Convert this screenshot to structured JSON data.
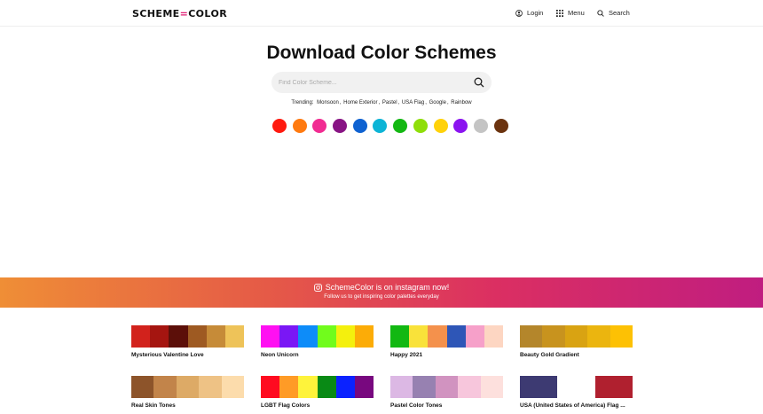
{
  "header": {
    "logo_left": "SCHEME",
    "logo_mid": "=",
    "logo_right": "COLOR",
    "nav": {
      "login": "Login",
      "menu": "Menu",
      "search": "Search"
    }
  },
  "hero": {
    "title": "Download Color Schemes",
    "search_placeholder": "Find Color Scheme...",
    "trending_label": "Trending:",
    "trending": [
      "Monsoon",
      "Home Exterior",
      "Pastel",
      "USA Flag",
      "Google",
      "Rainbow"
    ],
    "color_dots": [
      "#ff1a0f",
      "#ff7a10",
      "#f12c92",
      "#881484",
      "#0f62d1",
      "#0db4d6",
      "#14b813",
      "#8fde0a",
      "#ffd20a",
      "#8b14f0",
      "#c4c4c4",
      "#6b330f"
    ]
  },
  "banner": {
    "title": "SchemeColor is on instagram now!",
    "subtitle": "Follow us to get inspiring color palettes everyday"
  },
  "palettes": [
    {
      "name": "Mysterious Valentine Love",
      "colors": [
        "#d2221c",
        "#a51510",
        "#5c0f09",
        "#9e5a22",
        "#c68b38",
        "#eec359"
      ]
    },
    {
      "name": "Neon Unicorn",
      "colors": [
        "#ff10f2",
        "#7a17f5",
        "#0d8cf9",
        "#71fc1c",
        "#f4f00d",
        "#fcac07"
      ]
    },
    {
      "name": "Happy 2021",
      "colors": [
        "#12b812",
        "#f9e23a",
        "#f4914c",
        "#2e56b7",
        "#f6a0c9",
        "#fdd6c2"
      ]
    },
    {
      "name": "Beauty Gold Gradient",
      "colors": [
        "#b4862b",
        "#c8931e",
        "#d9a312",
        "#ebb50f",
        "#fdc104"
      ]
    },
    {
      "name": "Real Skin Tones",
      "colors": [
        "#8d542a",
        "#c2844a",
        "#ddaa66",
        "#eec285",
        "#fcdcac"
      ]
    },
    {
      "name": "LGBT Flag Colors",
      "colors": [
        "#ff0b20",
        "#ff9b26",
        "#fef33b",
        "#098a15",
        "#0b22ff",
        "#78087f"
      ]
    },
    {
      "name": "Pastel Color Tones",
      "colors": [
        "#dcb8e4",
        "#9781b1",
        "#d193c0",
        "#f7c6dc",
        "#fde0dd"
      ]
    },
    {
      "name": "USA (United States of America) Flag ...",
      "colors": [
        "#3d3a72",
        "#ffffff",
        "#b0202f"
      ]
    }
  ]
}
